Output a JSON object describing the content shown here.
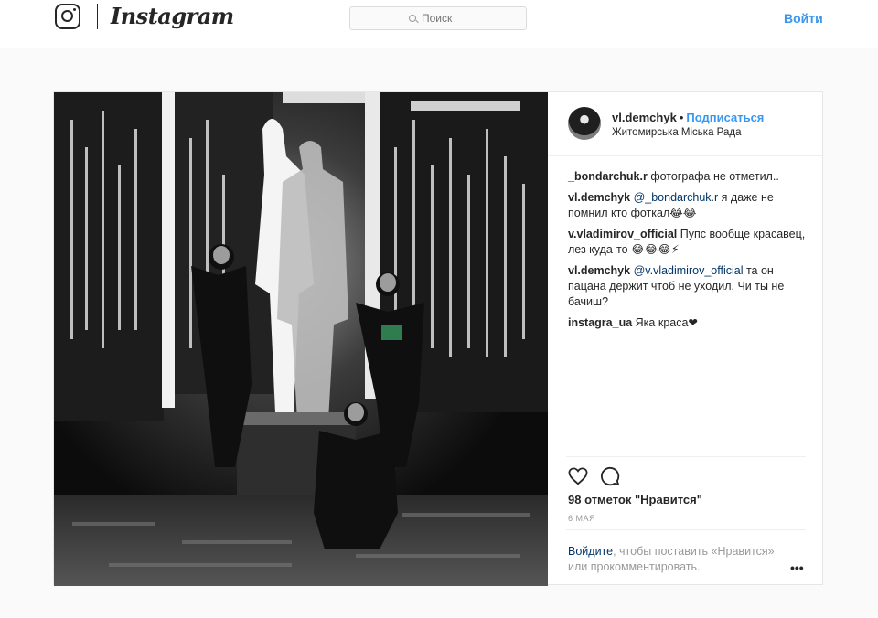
{
  "header": {
    "brand": "Instagram",
    "search_placeholder": "Поиск",
    "login_label": "Войти"
  },
  "post": {
    "author": "vl.demchyk",
    "separator": "•",
    "follow_label": "Подписаться",
    "location": "Житомирська Міська Рада",
    "comments": [
      {
        "user": "_bondarchuk.r",
        "mention": "",
        "text": "фотографа не отметил.."
      },
      {
        "user": "vl.demchyk",
        "mention": "@_bondarchuk.r",
        "text": "я даже не помнил кто фоткал😂😂"
      },
      {
        "user": "v.vladimirov_official",
        "mention": "",
        "text": "Пупс вообще красавец, лез куда-то 😂😂😂⚡"
      },
      {
        "user": "vl.demchyk",
        "mention": "@v.vladimirov_official",
        "text": "та он пацана держит чтоб не уходил. Чи ты не бачиш?"
      },
      {
        "user": "instagra_ua",
        "mention": "",
        "text": "Яка краса❤"
      }
    ],
    "likes": "98 отметок \"Нравится\"",
    "date": "6 МАЯ",
    "login_prompt_link": "Войдите",
    "login_prompt_text": ", чтобы поставить «Нравится» или прокомментировать.",
    "more_label": "•••"
  },
  "icons": {
    "heart": "heart-icon",
    "comment": "comment-icon",
    "search": "search-icon",
    "logo": "instagram-logo-icon"
  },
  "colors": {
    "accent": "#3897f0",
    "link_dark": "#003569",
    "text": "#262626",
    "muted": "#999999",
    "border": "#e6e6e6"
  }
}
